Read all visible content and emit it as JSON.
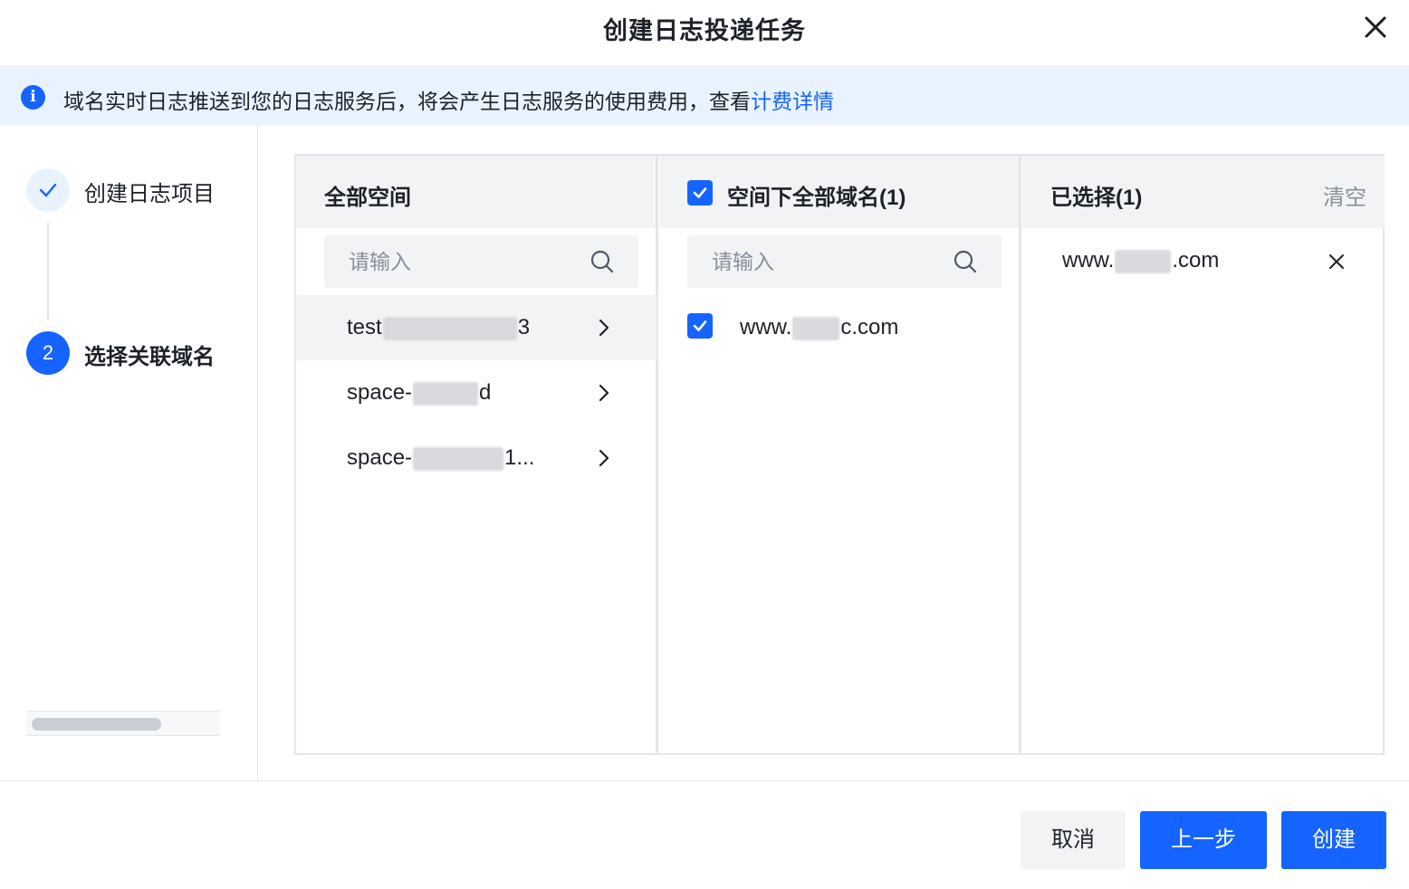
{
  "dialog": {
    "title": "创建日志投递任务",
    "close_icon": "close-icon"
  },
  "notice": {
    "text": "域名实时日志推送到您的日志服务后，将会产生日志服务的使用费用，查看",
    "link": "计费详情",
    "icon": "info-icon"
  },
  "steps": [
    {
      "index": "1",
      "label": "创建日志项目",
      "status": "done",
      "icon": "check-icon"
    },
    {
      "index": "2",
      "label": "选择关联域名",
      "status": "active"
    }
  ],
  "spaces_panel": {
    "title": "全部空间",
    "search_placeholder": "请输入",
    "items": [
      {
        "prefix": "test",
        "suffix": "3",
        "active": true
      },
      {
        "prefix": "space-",
        "suffix": "d",
        "active": false
      },
      {
        "prefix": "space-",
        "suffix": "1...",
        "active": false
      }
    ]
  },
  "domains_panel": {
    "title": "空间下全部域名(1)",
    "search_placeholder": "请输入",
    "items": [
      {
        "prefix": "www.",
        "suffix": "c.com",
        "checked": true
      }
    ]
  },
  "selected_panel": {
    "title": "已选择(1)",
    "clear_label": "清空",
    "items": [
      {
        "prefix": "www.",
        "suffix": ".com"
      }
    ]
  },
  "footer": {
    "cancel_label": "取消",
    "prev_label": "上一步",
    "create_label": "创建"
  },
  "colors": {
    "primary": "#1664ff",
    "notice_bg": "#e8f3ff",
    "panel_header_bg": "#f2f3f5"
  }
}
